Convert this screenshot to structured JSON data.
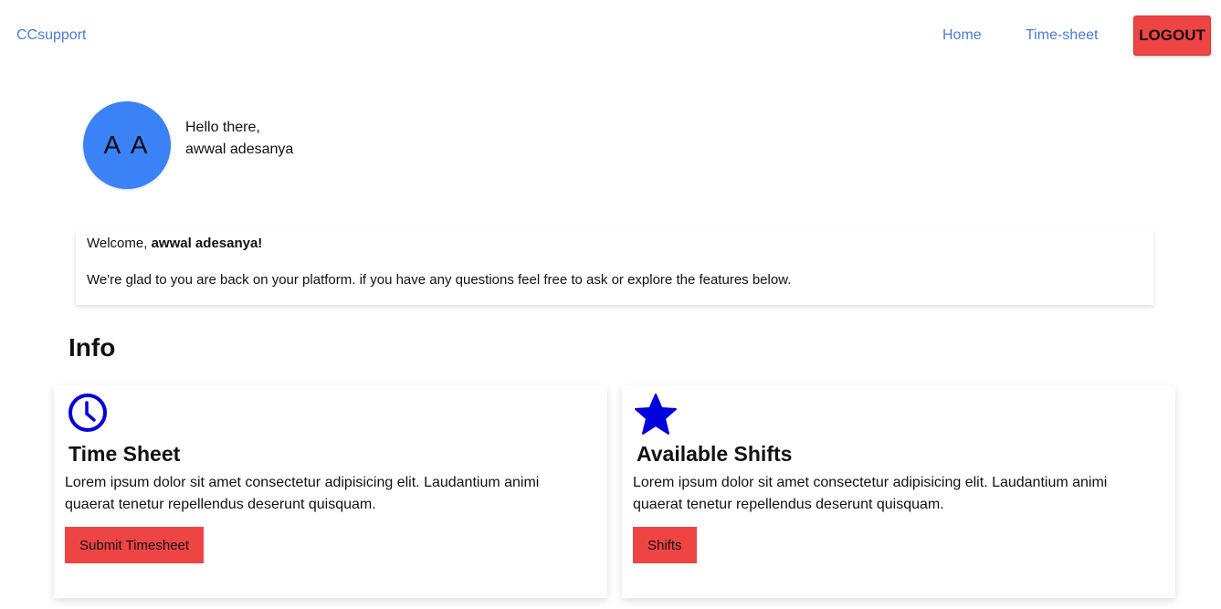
{
  "navbar": {
    "brand": "CCsupport",
    "links": [
      "Home",
      "Time-sheet"
    ],
    "logout_label": "LOGOUT"
  },
  "profile": {
    "initials": "A A",
    "greeting": "Hello there,",
    "name": "awwal adesanya"
  },
  "welcome": {
    "prefix": "Welcome, ",
    "name": "awwal adesanya!",
    "message": "We're glad to you are back on your platform. if you have any questions feel free to ask or explore the features below."
  },
  "info": {
    "heading": "Info",
    "cards": [
      {
        "icon": "clock-icon",
        "title": "Time Sheet",
        "text": "Lorem ipsum dolor sit amet consectetur adipisicing elit. Laudantium animi quaerat tenetur repellendus deserunt quisquam.",
        "button": "Submit Timesheet"
      },
      {
        "icon": "star-icon",
        "title": "Available Shifts",
        "text": "Lorem ipsum dolor sit amet consectetur adipisicing elit. Laudantium animi quaerat tenetur repellendus deserunt quisquam.",
        "button": "Shifts"
      }
    ]
  },
  "colors": {
    "accent_red": "#ef4444",
    "link_blue": "#4a7bd6",
    "avatar_blue": "#3b82f6",
    "icon_blue": "#0000dd"
  }
}
